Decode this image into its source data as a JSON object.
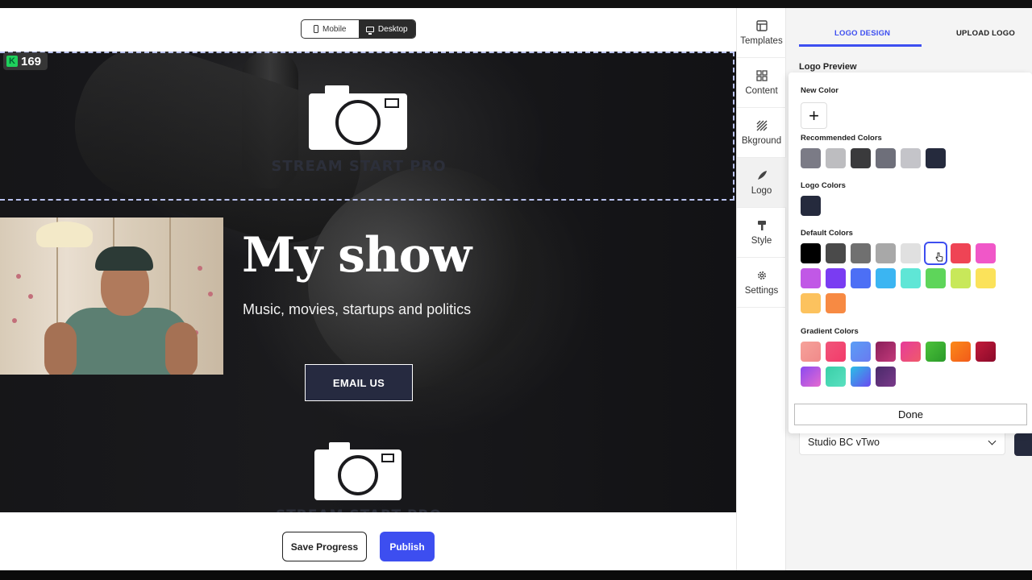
{
  "device_toggle": {
    "mobile_label": "Mobile",
    "desktop_label": "Desktop",
    "active": "Desktop"
  },
  "counter_badge": {
    "value": "169"
  },
  "site": {
    "header_logo_text": "STREAM START PRO",
    "hero_title": "My show",
    "hero_subtitle": "Music, movies, startups and politics",
    "cta_label": "EMAIL US",
    "footer_logo_text": "STREAM START PRO"
  },
  "footer_actions": {
    "save_label": "Save Progress",
    "publish_label": "Publish"
  },
  "rail": {
    "items": [
      {
        "label": "Templates",
        "icon": "templates-icon"
      },
      {
        "label": "Content",
        "icon": "content-icon"
      },
      {
        "label": "Bkground",
        "icon": "background-icon"
      },
      {
        "label": "Logo",
        "icon": "logo-icon"
      },
      {
        "label": "Style",
        "icon": "style-icon"
      },
      {
        "label": "Settings",
        "icon": "gear-icon"
      }
    ],
    "active": "Logo"
  },
  "panel": {
    "tab_design": "LOGO DESIGN",
    "tab_upload": "UPLOAD LOGO",
    "logo_preview_label": "Logo Preview",
    "font_value": "Studio BC vTwo"
  },
  "color_picker": {
    "new_color_label": "New Color",
    "recommended_label": "Recommended Colors",
    "recommended": [
      "#7b7b86",
      "#bdbdc0",
      "#3a3a3c",
      "#6e6f7a",
      "#c4c4c9",
      "#252a3d"
    ],
    "logo_colors_label": "Logo Colors",
    "logo_colors": [
      "#252a3d"
    ],
    "default_label": "Default Colors",
    "default_colors": [
      "#000000",
      "#4a4a4a",
      "#707070",
      "#a8a8a8",
      "#e0e0e0",
      "#ffffff",
      "#ef4455",
      "#f057c8",
      "#c158e6",
      "#7a3cf2",
      "#4c6ff5",
      "#3bb5f2",
      "#5fe6d6",
      "#5ed55a",
      "#c8e85a",
      "#fbe25a",
      "#fcc25e",
      "#f78a43"
    ],
    "selected_default": "#ffffff",
    "gradient_label": "Gradient Colors",
    "gradient_colors": [
      [
        "#f6a29a",
        "#f08a8a"
      ],
      [
        "#f1557a",
        "#f23b6a"
      ],
      [
        "#5a9ef6",
        "#6a7af0"
      ],
      [
        "#8a1f5a",
        "#c23a7a"
      ],
      [
        "#e63b9a",
        "#f05a6a"
      ],
      [
        "#4cc23a",
        "#2a9a2a"
      ],
      [
        "#fb8a1a",
        "#f25a1a"
      ],
      [
        "#c21a3a",
        "#8a0a2a"
      ],
      [
        "#8a4af0",
        "#e66ad0"
      ],
      [
        "#3acfa8",
        "#5ae0c0"
      ],
      [
        "#2ac0e6",
        "#6a4af0"
      ],
      [
        "#4a2a6a",
        "#7a3a8a"
      ]
    ],
    "done_label": "Done"
  }
}
